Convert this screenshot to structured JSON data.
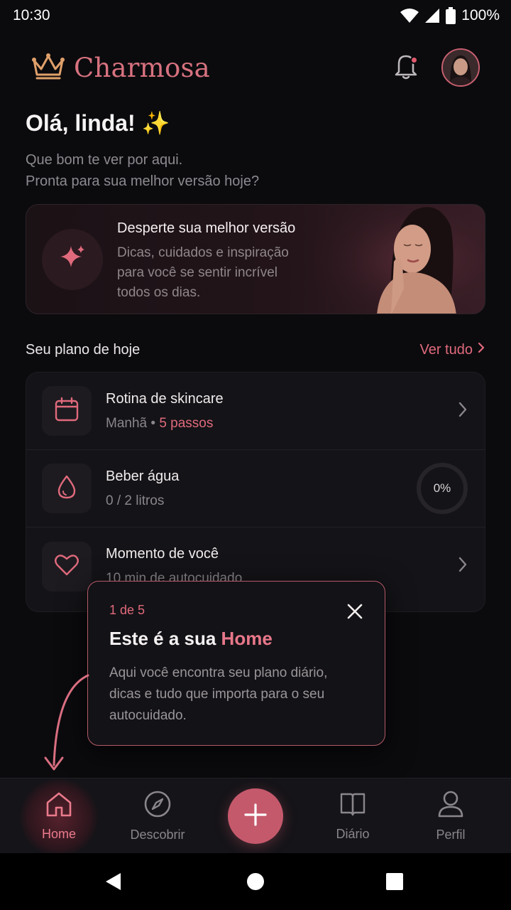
{
  "status_bar": {
    "time": "10:30",
    "battery": "100%"
  },
  "header": {
    "app_name": "Charmosa",
    "notification_dot": true
  },
  "greeting": {
    "title": "Olá, linda! ✨",
    "line1": "Que bom te ver por aqui.",
    "line2": "Pronta para sua melhor versão hoje?"
  },
  "hero": {
    "title": "Desperte sua melhor versão",
    "desc_line1": "Dicas, cuidados e inspiração",
    "desc_line2": "para você se sentir incrível",
    "desc_line3": "todos os dias."
  },
  "plan_section": {
    "title": "Seu plano de hoje",
    "see_all": "Ver tudo"
  },
  "plan_items": [
    {
      "title": "Rotina de skincare",
      "sub_prefix": "Manhã • ",
      "sub_accent": "5 passos",
      "icon": "calendar-icon"
    },
    {
      "title": "Beber água",
      "sub": "0 / 2 litros",
      "progress": "0%",
      "progress_value": 0,
      "icon": "water-drop-icon"
    },
    {
      "title": "Momento de você",
      "sub": "10 min de autocuidado",
      "icon": "heart-icon"
    }
  ],
  "tooltip": {
    "step": "1 de 5",
    "title_prefix": "Este é a sua ",
    "title_accent": "Home",
    "desc_line1": "Aqui você encontra seu plano diário,",
    "desc_line2": "dicas e tudo que importa para o seu",
    "desc_line3": "autocuidado."
  },
  "bottom_nav": {
    "home": "Home",
    "discover": "Descobrir",
    "diary": "Diário",
    "profile": "Perfil",
    "active": "home"
  },
  "colors": {
    "accent": "#e06a7c",
    "fab": "#c5596c",
    "background": "#0b0b0e"
  }
}
